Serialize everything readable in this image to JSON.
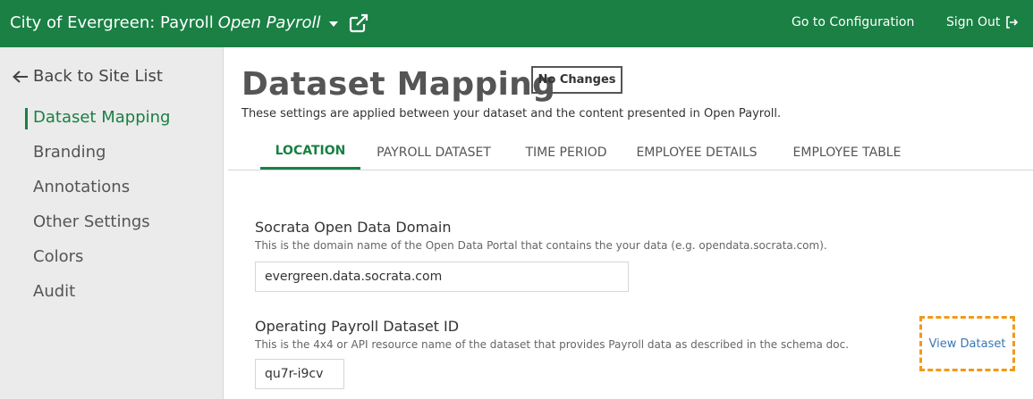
{
  "header": {
    "site_name": "City of Evergreen: Payroll",
    "app_name": "Open Payroll",
    "config_link": "Go to Configuration",
    "signout_link": "Sign Out"
  },
  "sidebar": {
    "back_label": "Back to Site List",
    "items": [
      {
        "label": "Dataset Mapping"
      },
      {
        "label": "Branding"
      },
      {
        "label": "Annotations"
      },
      {
        "label": "Other Settings"
      },
      {
        "label": "Colors"
      },
      {
        "label": "Audit"
      }
    ]
  },
  "main": {
    "title": "Dataset Mapping",
    "status": "No Changes",
    "description": "These settings are applied between your dataset and the content presented in Open Payroll.",
    "tabs": [
      {
        "label": "LOCATION"
      },
      {
        "label": "PAYROLL DATASET"
      },
      {
        "label": "TIME PERIOD"
      },
      {
        "label": "EMPLOYEE DETAILS"
      },
      {
        "label": "EMPLOYEE TABLE"
      }
    ],
    "fields": {
      "domain": {
        "label": "Socrata Open Data Domain",
        "help": "This is the domain name of the Open Data Portal that contains the your data (e.g. opendata.socrata.com).",
        "value": "evergreen.data.socrata.com"
      },
      "dataset_id": {
        "label": "Operating Payroll Dataset ID",
        "help": "This is the 4x4 or API resource name of the dataset that provides Payroll data as described in the schema doc.",
        "value": "qu7r-i9cv",
        "view_link": "View Dataset"
      }
    }
  },
  "colors": {
    "brand_green": "#1a8044",
    "highlight_orange": "#f09a1a",
    "link_blue": "#3a77b5"
  }
}
